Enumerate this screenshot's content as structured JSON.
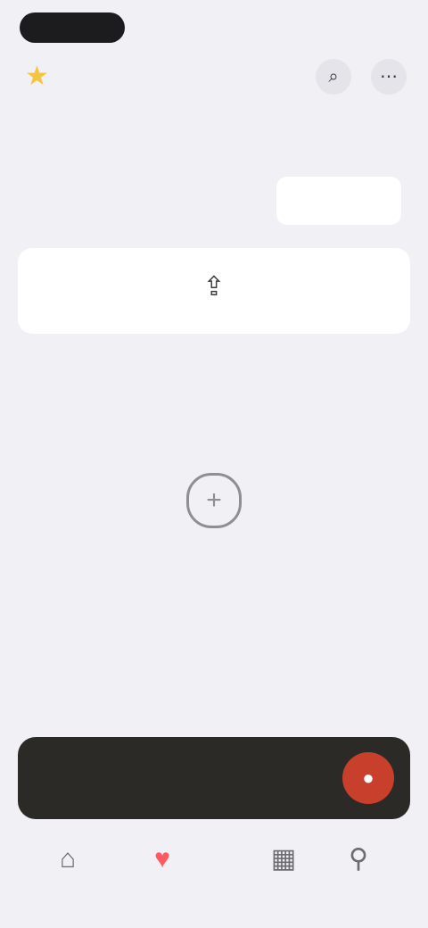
{
  "status": {
    "pill": "",
    "right": ""
  },
  "header": {
    "title": "",
    "star_icon": "star-icon",
    "buttons": [
      {
        "name": "search-icon",
        "glyph": "⌕"
      },
      {
        "name": "more-icon",
        "glyph": "⋯"
      }
    ]
  },
  "segments": [
    {
      "label": "",
      "active": false
    },
    {
      "label": "",
      "active": false
    },
    {
      "label": "",
      "active": true
    }
  ],
  "import_card": {
    "icon": "upload-icon",
    "label": ""
  },
  "empty_state": {
    "icon": "plus-circle-icon",
    "title": "",
    "subtitle": ""
  },
  "player": {
    "text": "",
    "action_icon": "record-icon"
  },
  "tabs": [
    {
      "name": "home-icon",
      "glyph": "⌂",
      "label": "",
      "active": false
    },
    {
      "name": "heart-icon",
      "glyph": "♥",
      "label": "",
      "active": true
    },
    {
      "name": "library-icon",
      "glyph": "▦",
      "label": "",
      "active": false
    },
    {
      "name": "profile-icon",
      "glyph": "⚲",
      "label": "",
      "active": false
    }
  ],
  "colors": {
    "background": "#f0f0f5",
    "player_bg": "#2c2a26",
    "accent": "#c8402c",
    "active_tab": "#ff5a5f",
    "star": "#f5c542"
  }
}
